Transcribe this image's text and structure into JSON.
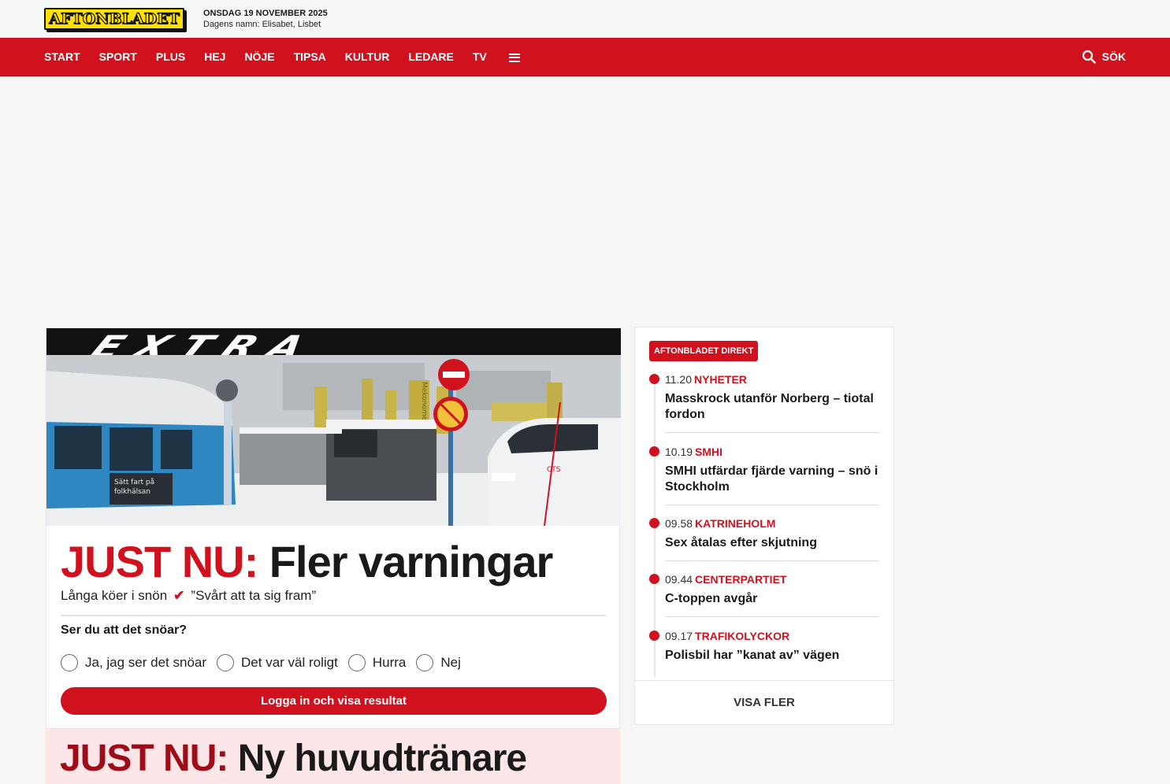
{
  "header": {
    "logo_text": "AFTONBLADET",
    "date": "ONSDAG 19 NOVEMBER 2025",
    "namnsdag": "Dagens namn: Elisabet, Lisbet"
  },
  "nav": {
    "items": [
      "START",
      "SPORT",
      "PLUS",
      "HEJ",
      "NÖJE",
      "TIPSA",
      "KULTUR",
      "LEDARE",
      "TV"
    ],
    "search_label": "SÖK"
  },
  "article": {
    "banner": "EXTRA",
    "kicker": "JUST NU:",
    "title": "Fler varningar",
    "sub_left": "Långa köer i snön",
    "sub_right": "”Svårt att ta sig fram”",
    "poll": {
      "question": "Ser du att det snöar?",
      "options": [
        "Ja, jag ser det snöar",
        "Det var väl roligt",
        "Hurra",
        "Nej"
      ],
      "button": "Logga in och visa resultat"
    },
    "hero_texts": {
      "bus_ad_line1": "Sätt fart på",
      "bus_ad_line2": "folkhälsan",
      "sign_text": "Mekonomen",
      "van_text": "CTS"
    }
  },
  "article2": {
    "kicker": "JUST NU:",
    "title": "Ny huvudtränare"
  },
  "direkt": {
    "badge": "AFTONBLADET DIREKT",
    "items": [
      {
        "time": "11.20",
        "category": "NYHETER",
        "title": "Masskrock utanför Norberg – tiotal fordon"
      },
      {
        "time": "10.19",
        "category": "SMHI",
        "title": "SMHI utfärdar fjärde varning – snö i Stockholm"
      },
      {
        "time": "09.58",
        "category": "KATRINEHOLM",
        "title": "Sex åtalas efter skjutning"
      },
      {
        "time": "09.44",
        "category": "CENTERPARTIET",
        "title": "C-toppen avgår"
      },
      {
        "time": "09.17",
        "category": "TRAFIKOLYCKOR",
        "title": "Polisbil har ”kanat av” vägen"
      }
    ],
    "more_label": "VISA FLER"
  },
  "colors": {
    "brand_red": "#d0121f",
    "logo_yellow": "#ffe100",
    "live_bg": "#ffffff",
    "secondary_bg": "#fde6e8"
  }
}
